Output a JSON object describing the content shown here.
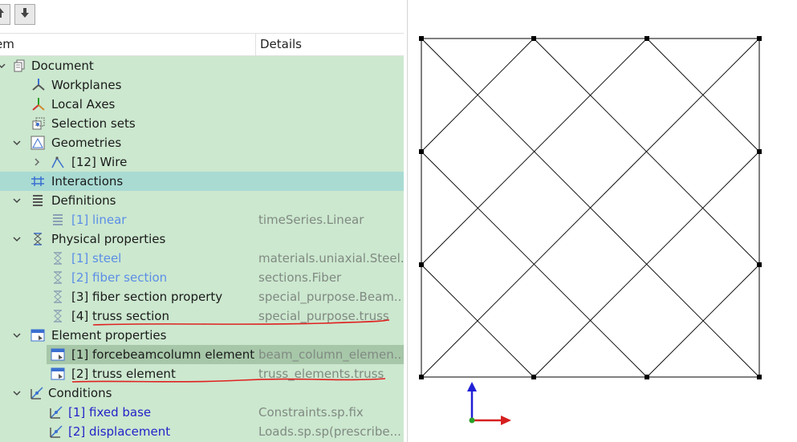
{
  "toolbar": {
    "up_icon": "arrow-up-icon",
    "down_icon": "arrow-down-icon"
  },
  "tree_header": {
    "item": "em",
    "details": "Details"
  },
  "tree": {
    "document": {
      "label": "Document"
    },
    "workplanes": {
      "label": "Workplanes"
    },
    "local_axes": {
      "label": "Local Axes"
    },
    "selection_sets": {
      "label": "Selection sets"
    },
    "geometries": {
      "label": "Geometries"
    },
    "wire": {
      "label": "[12] Wire"
    },
    "interactions": {
      "label": "Interactions"
    },
    "definitions": {
      "label": "Definitions"
    },
    "linear": {
      "label": "[1] linear",
      "detail": "timeSeries.Linear"
    },
    "physical_properties": {
      "label": "Physical properties"
    },
    "steel": {
      "label": "[1] steel",
      "detail": "materials.uniaxial.Steel..."
    },
    "fiber_section": {
      "label": "[2] fiber section",
      "detail": "sections.Fiber"
    },
    "fiber_section_property": {
      "label": "[3] fiber section property",
      "detail": "special_purpose.Beam..."
    },
    "truss_section": {
      "label": "[4] truss section",
      "detail": "special_purpose.truss"
    },
    "element_properties": {
      "label": "Element properties"
    },
    "forcebeamcolumn": {
      "label": "[1] forcebeamcolumn element",
      "detail": "beam_column_elemen..."
    },
    "truss_element": {
      "label": "[2] truss element",
      "detail": "truss_elements.truss"
    },
    "conditions": {
      "label": "Conditions"
    },
    "fixed_base": {
      "label": "[1] fixed base",
      "detail": "Constraints.sp.fix"
    },
    "displacement": {
      "label": "[2] displacement",
      "detail": "Loads.sp.sp(prescribe..."
    }
  },
  "colors": {
    "tree_background": "#cce8cf",
    "selected_row": "#a9dbd3",
    "highlighted_row": "#a7c7a9",
    "link_text": "#5b8ee6",
    "condition_text": "#2323c8",
    "annotation_red": "#e02020",
    "axis_y": "#1f1fd6",
    "axis_x": "#d61f1f",
    "axis_origin": "#2aa02a"
  }
}
